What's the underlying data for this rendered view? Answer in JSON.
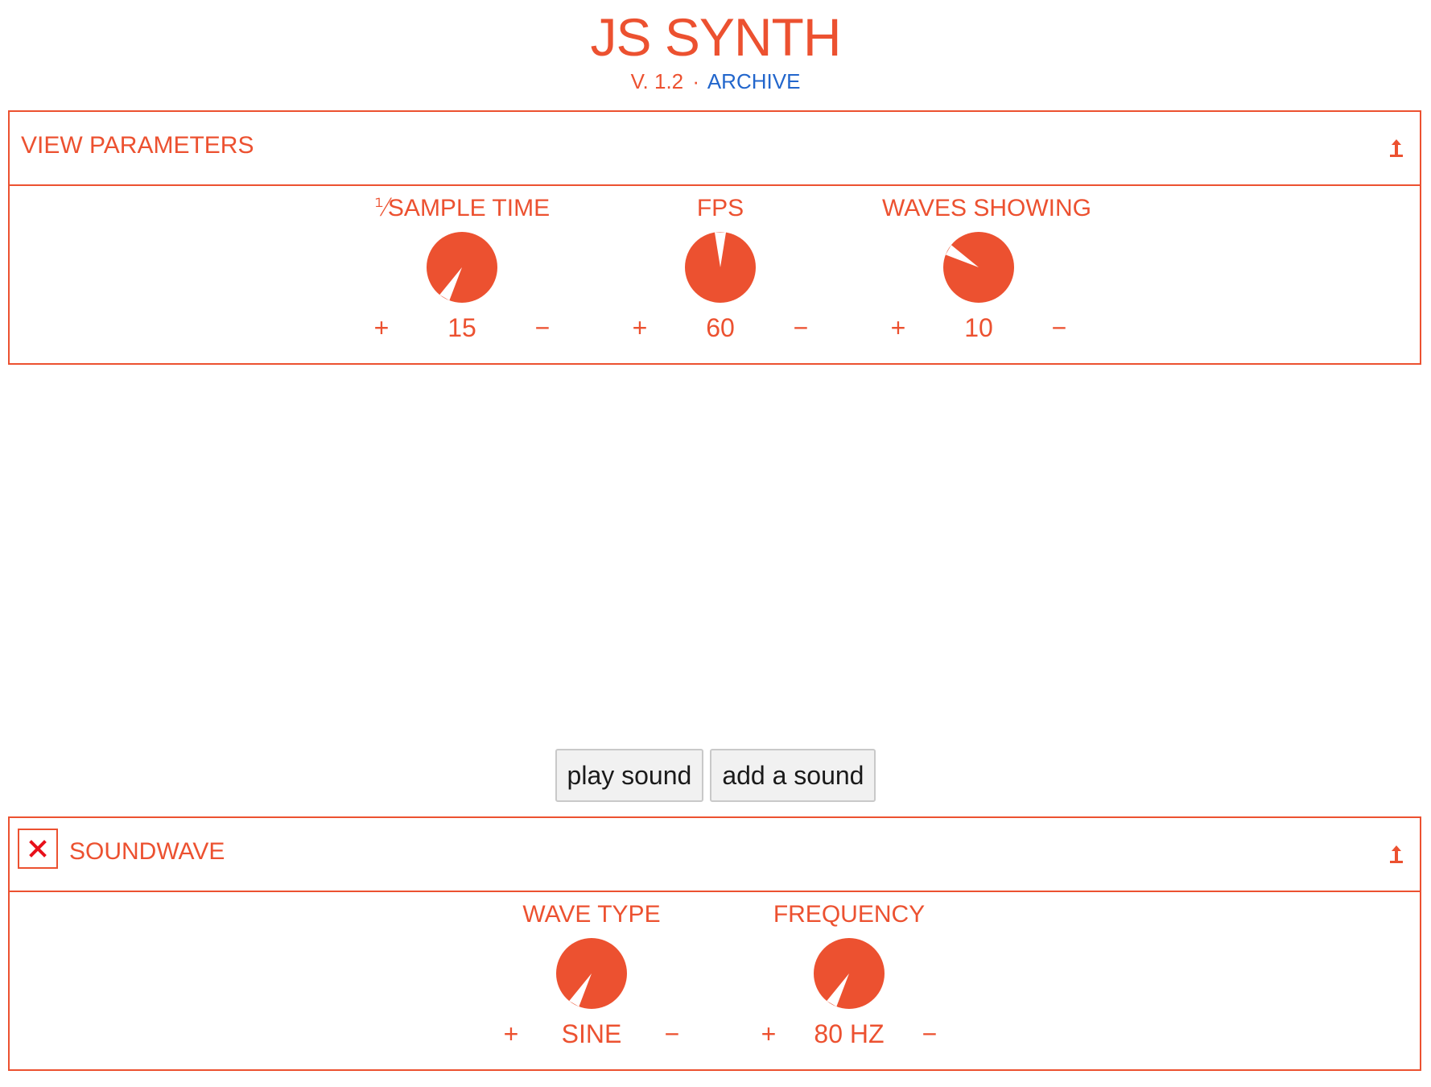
{
  "app": {
    "title": "JS SYNTH",
    "version": "V. 1.2",
    "separator": "·",
    "archive_link": "ARCHIVE"
  },
  "colors": {
    "accent": "#ec5130",
    "link": "#2266cc",
    "button_bg": "#f1f1f1",
    "button_border": "#c9c9c9"
  },
  "view_parameters": {
    "title": "VIEW PARAMETERS",
    "collapse_icon": "collapse-up-arrow-icon",
    "knobs": [
      {
        "label": "⅟SAMPLE TIME",
        "value": "15",
        "plus": "+",
        "minus": "−",
        "pointer_angle_deg": 210
      },
      {
        "label": "FPS",
        "value": "60",
        "plus": "+",
        "minus": "−",
        "pointer_angle_deg": 0
      },
      {
        "label": "WAVES SHOWING",
        "value": "10",
        "plus": "+",
        "minus": "−",
        "pointer_angle_deg": 300
      }
    ]
  },
  "actions": {
    "play_label": "play sound",
    "add_label": "add a sound"
  },
  "soundwave": {
    "title": "SOUNDWAVE",
    "close_icon": "close-x-icon",
    "collapse_icon": "collapse-up-arrow-icon",
    "knobs": [
      {
        "label": "WAVE TYPE",
        "value": "SINE",
        "plus": "+",
        "minus": "−",
        "pointer_angle_deg": 210
      },
      {
        "label": "FREQUENCY",
        "value": "80 HZ",
        "plus": "+",
        "minus": "−",
        "pointer_angle_deg": 210
      }
    ]
  }
}
